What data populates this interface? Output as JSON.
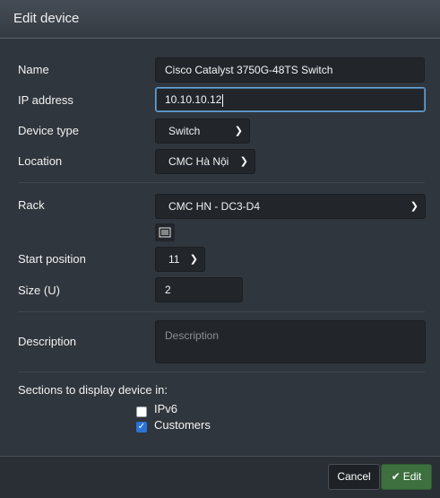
{
  "dialog": {
    "title": "Edit device"
  },
  "form": {
    "name": {
      "label": "Name",
      "value": "Cisco Catalyst 3750G-48TS Switch"
    },
    "ip": {
      "label": "IP address",
      "value": "10.10.10.12"
    },
    "device_type": {
      "label": "Device type",
      "value": "Switch"
    },
    "location": {
      "label": "Location",
      "value": "CMC Hà Nội"
    },
    "rack": {
      "label": "Rack",
      "value": "CMC HN - DC3-D4",
      "button_icon": "rack-list-icon"
    },
    "start_position": {
      "label": "Start position",
      "value": "11"
    },
    "size": {
      "label": "Size (U)",
      "value": "2"
    },
    "description": {
      "label": "Description",
      "placeholder": "Description",
      "value": ""
    },
    "sections": {
      "label": "Sections to display device in:",
      "items": [
        {
          "label": "IPv6",
          "checked": false
        },
        {
          "label": "Customers",
          "checked": true
        }
      ]
    }
  },
  "footer": {
    "cancel_label": "Cancel",
    "edit_label": "Edit",
    "edit_icon": "check-icon"
  },
  "colors": {
    "accent": "#3d6f3f",
    "focus": "#66a3d9",
    "checkbox": "#2b74d6"
  }
}
